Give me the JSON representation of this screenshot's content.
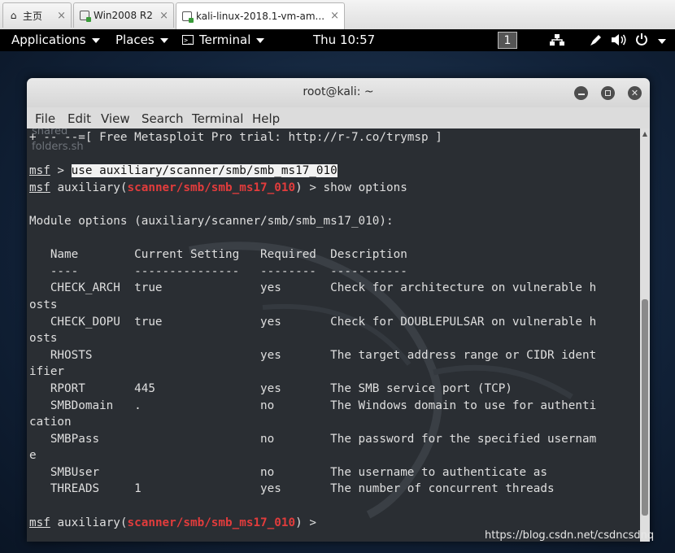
{
  "browser_tabs": [
    {
      "label": "主页",
      "icon": "home-icon"
    },
    {
      "label": "Win2008 R2",
      "icon": "vm-icon"
    },
    {
      "label": "kali-linux-2018.1-vm-am...",
      "icon": "vm-icon",
      "active": true
    }
  ],
  "panel": {
    "applications": "Applications",
    "places": "Places",
    "terminal": "Terminal",
    "clock": "Thu 10:57",
    "workspace": "1"
  },
  "window": {
    "title": "root@kali: ~",
    "menu": [
      "File",
      "Edit",
      "View",
      "Search",
      "Terminal",
      "Help"
    ]
  },
  "terminal": {
    "ghost_text": [
      "shared",
      "folders.sh"
    ],
    "promo_line": "+ -- --=[ Free Metasploit Pro trial: http://r-7.co/trymsp ]",
    "prompt": "msf",
    "command_1": "use auxiliary/scanner/smb/smb_ms17_010",
    "module_prefix": "auxiliary(",
    "module_name": "scanner/smb/smb_ms17_010",
    "module_suffix": ")",
    "command_2": "show options",
    "module_options_header": "Module options (auxiliary/scanner/smb/smb_ms17_010):",
    "columns": [
      "Name",
      "Current Setting",
      "Required",
      "Description"
    ],
    "underlines": [
      "----",
      "---------------",
      "--------",
      "-----------"
    ],
    "options": [
      {
        "name": "CHECK_ARCH",
        "setting": "true",
        "required": "yes",
        "description": "Check for architecture on vulnerable h",
        "wrap": "osts"
      },
      {
        "name": "CHECK_DOPU",
        "setting": "true",
        "required": "yes",
        "description": "Check for DOUBLEPULSAR on vulnerable h",
        "wrap": "osts"
      },
      {
        "name": "RHOSTS",
        "setting": "",
        "required": "yes",
        "description": "The target address range or CIDR ident",
        "wrap": "ifier"
      },
      {
        "name": "RPORT",
        "setting": "445",
        "required": "yes",
        "description": "The SMB service port (TCP)",
        "wrap": ""
      },
      {
        "name": "SMBDomain",
        "setting": ".",
        "required": "no",
        "description": "The Windows domain to use for authenti",
        "wrap": "cation"
      },
      {
        "name": "SMBPass",
        "setting": "",
        "required": "no",
        "description": "The password for the specified usernam",
        "wrap": "e"
      },
      {
        "name": "SMBUser",
        "setting": "",
        "required": "no",
        "description": "The username to authenticate as",
        "wrap": ""
      },
      {
        "name": "THREADS",
        "setting": "1",
        "required": "yes",
        "description": "The number of concurrent threads",
        "wrap": ""
      }
    ]
  },
  "watermark": "https://blog.csdn.net/csdncsdnq",
  "colors": {
    "module_red": "#e23c3c",
    "terminal_bg": "#2a2e33",
    "panel_bg": "#000000"
  }
}
